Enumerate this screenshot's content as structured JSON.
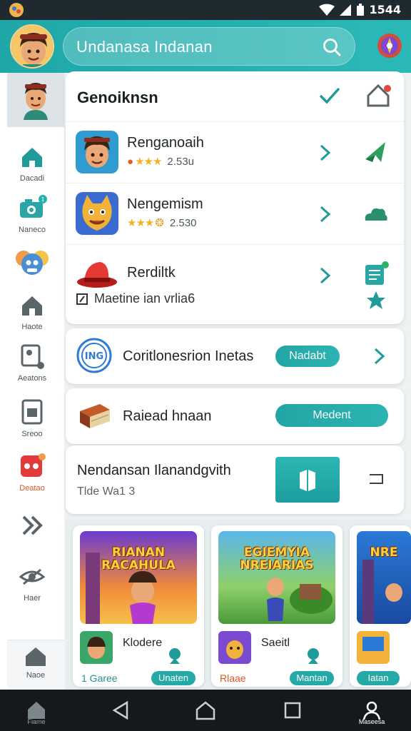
{
  "status_bar": {
    "time": "1544"
  },
  "header": {
    "search_value": "Undanasa Indanan"
  },
  "sidebar": {
    "items": [
      {
        "label": "Dacadi"
      },
      {
        "label": "Naneco"
      },
      {
        "label": "Haote"
      },
      {
        "label": "Aeatons"
      },
      {
        "label": "Sreoo"
      },
      {
        "label": "Deatao"
      },
      {
        "label": "Haer"
      },
      {
        "label": "Naoe"
      }
    ]
  },
  "card1": {
    "title": "Genoiknsn",
    "rows": [
      {
        "name": "Renganoaih",
        "rating": "2.53u"
      },
      {
        "name": "Nengemism",
        "rating": "2.530"
      },
      {
        "name": "Rerdiltk"
      }
    ],
    "footer": "Maetine ian vrlia6"
  },
  "card2": {
    "text": "Coritlonesrion Inetas",
    "button": "Nadabt"
  },
  "card3": {
    "text": "Raiead hnaan",
    "button": "Medent"
  },
  "card4": {
    "title": "Nendansan Ilanandgvith",
    "subtitle": "Tlde Wa1 3"
  },
  "tiles": [
    {
      "banner_title": "RIANAN RACAHULA",
      "name": "Klodere",
      "sub": "1 Garee",
      "button": "Unaten"
    },
    {
      "banner_title": "EGIEMYIA NREIARIAS",
      "name": "Saeitl",
      "sub": "Rlaae",
      "button": "Mantan"
    },
    {
      "banner_title": "NRE",
      "name": "",
      "sub": "",
      "button": "Iatan"
    }
  ],
  "navbar": {
    "left_label": "Fiame",
    "right_label": "Maseesa"
  },
  "colors": {
    "accent": "#22a5a5",
    "header": "#1fa7a8",
    "star": "#f4b324"
  }
}
